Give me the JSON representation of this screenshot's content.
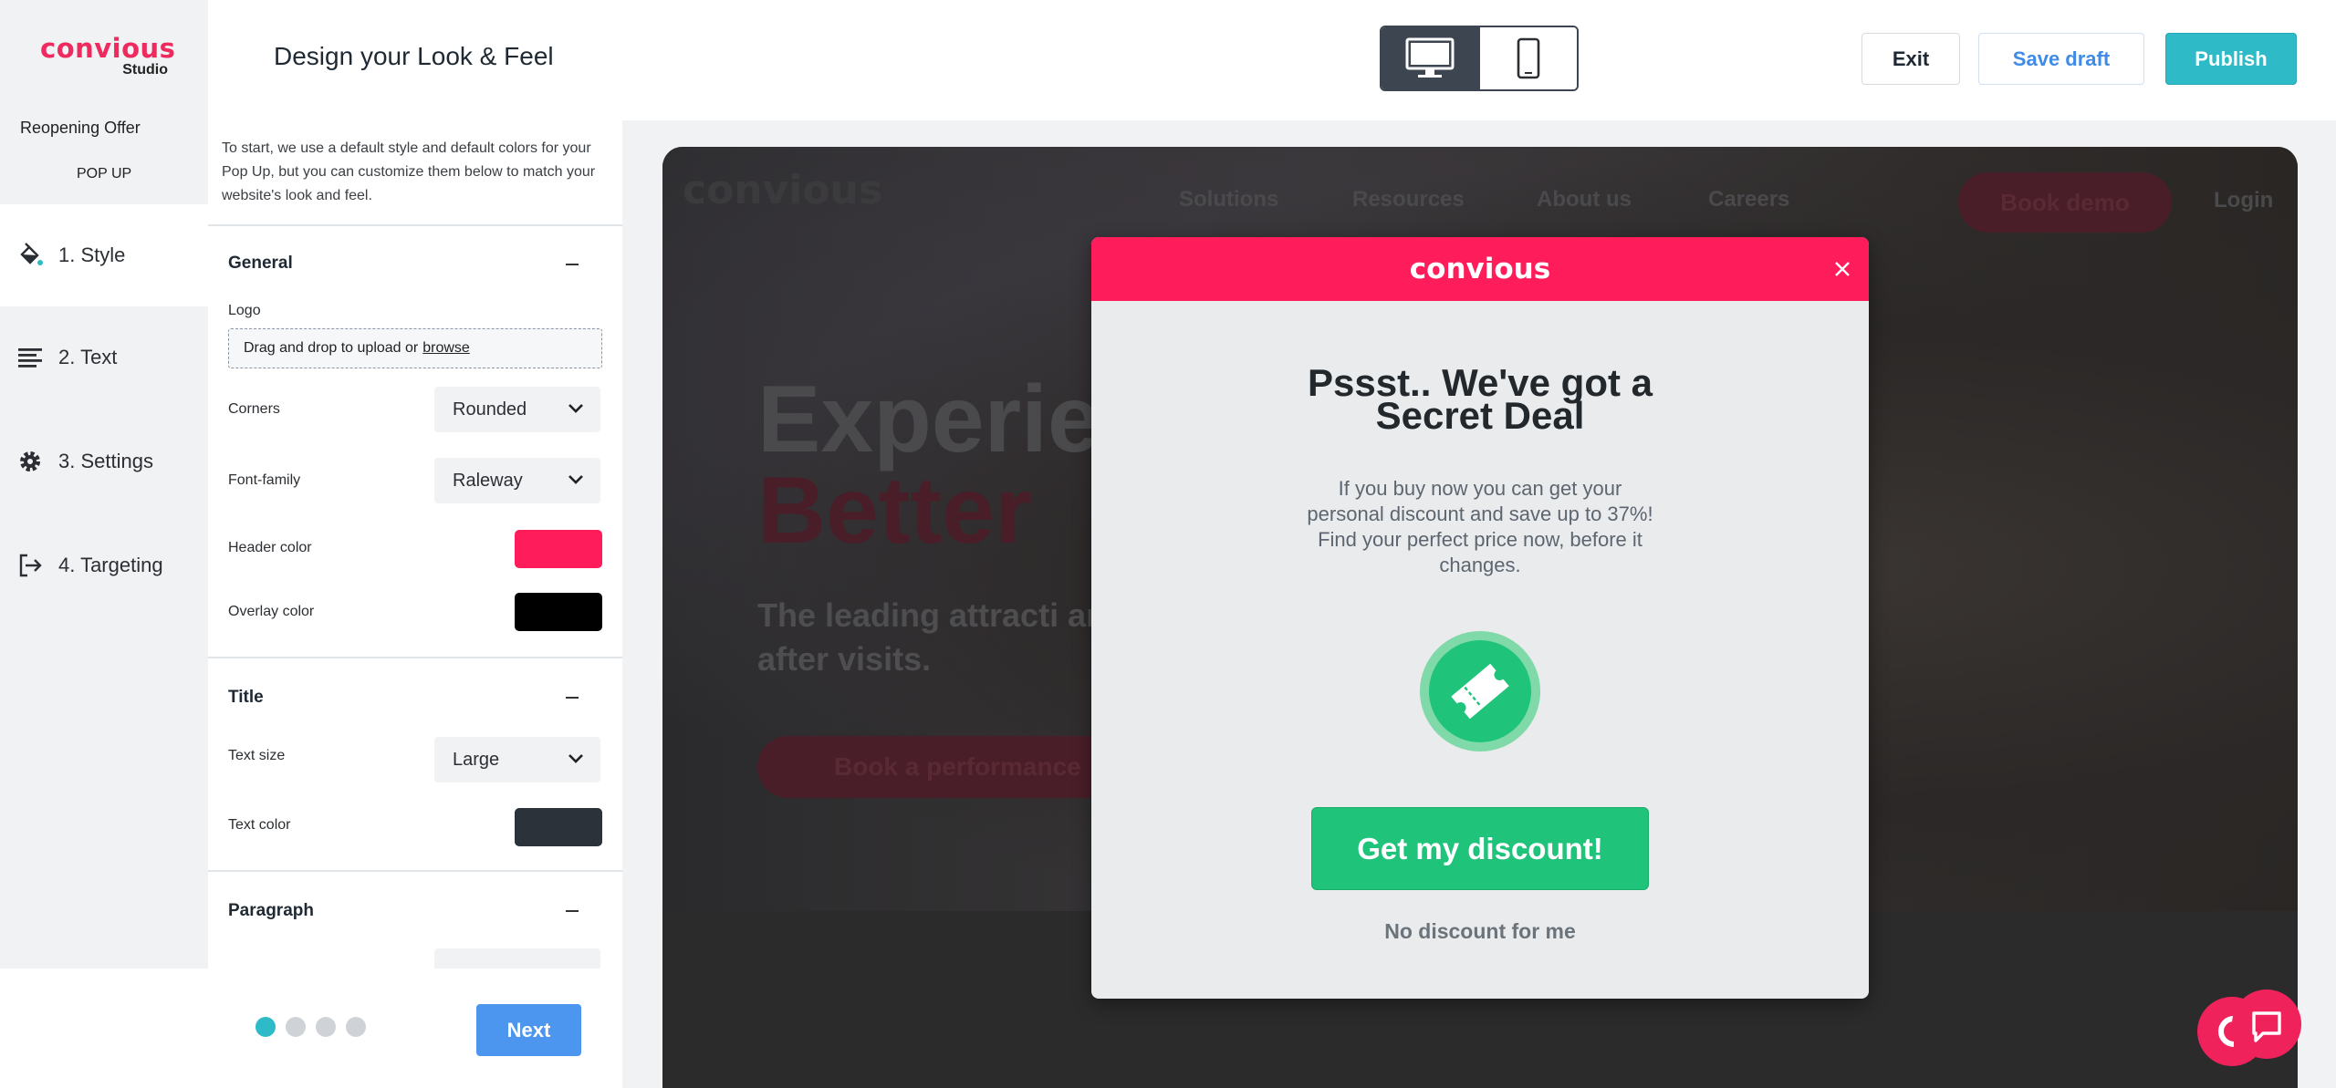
{
  "brand": {
    "name": "convious",
    "sub": "Studio"
  },
  "project": {
    "name": "Reopening Offer",
    "type": "POP UP"
  },
  "nav": {
    "items": [
      {
        "label": "1. Style",
        "icon": "paint-bucket-icon",
        "active": true
      },
      {
        "label": "2. Text",
        "icon": "text-lines-icon",
        "active": false
      },
      {
        "label": "3. Settings",
        "icon": "gear-icon",
        "active": false
      },
      {
        "label": "4. Targeting",
        "icon": "exit-arrow-icon",
        "active": false
      }
    ]
  },
  "header": {
    "title": "Design your Look & Feel",
    "device": {
      "selected": "desktop",
      "options": [
        "desktop-icon",
        "mobile-icon"
      ]
    },
    "exit_label": "Exit",
    "save_draft_label": "Save draft",
    "publish_label": "Publish"
  },
  "settings": {
    "intro": "To start, we use a default style and default colors for your Pop Up, but you can customize them below to match your website's look and feel.",
    "general": {
      "title": "General",
      "logo_label": "Logo",
      "logo_drop_text": "Drag and drop to upload or",
      "logo_browse": "browse",
      "corners_label": "Corners",
      "corners_value": "Rounded",
      "font_label": "Font-family",
      "font_value": "Raleway",
      "header_color_label": "Header color",
      "header_color": "#FE1C5B",
      "overlay_color_label": "Overlay color",
      "overlay_color": "#000000"
    },
    "title_section": {
      "title": "Title",
      "text_size_label": "Text size",
      "text_size_value": "Large",
      "text_color_label": "Text color",
      "text_color": "#2B323A"
    },
    "paragraph_section": {
      "title": "Paragraph"
    }
  },
  "footer": {
    "step": 1,
    "steps": 4,
    "next_label": "Next"
  },
  "preview": {
    "site": {
      "logo": "convious",
      "nav": [
        "Solutions",
        "Resources",
        "About us",
        "Careers"
      ],
      "book_demo": "Book demo",
      "login": "Login",
      "hero_line1": "Experien",
      "hero_line2": "Better",
      "hero_sub": "The leading attracti and after visits.",
      "hero_cta": "Book a performance"
    },
    "popup": {
      "logo": "convious",
      "title_line1": "Pssst.. We've got a",
      "title_line2": "Secret Deal",
      "text": "If you buy now you can get your personal discount and save up to 37%! Find your perfect price now, before it changes.",
      "cta": "Get my discount!",
      "decline": "No discount for me",
      "icon": "ticket-icon"
    }
  },
  "colors": {
    "accent": "#2FBAC8",
    "brand": "#EE2A5F",
    "cta": "#1FC47A",
    "next": "#4D96EF"
  }
}
